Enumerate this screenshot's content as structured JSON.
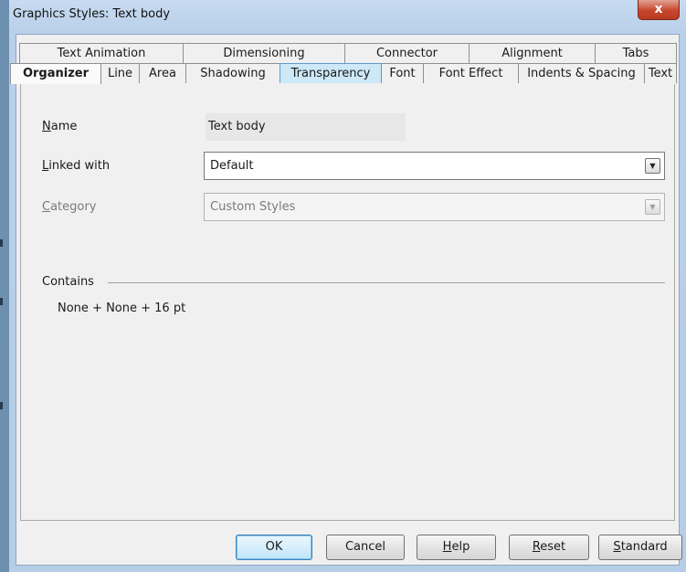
{
  "window": {
    "title": "Graphics Styles: Text body",
    "close_glyph": "x"
  },
  "tabs_back": [
    {
      "label": "Text Animation"
    },
    {
      "label": "Dimensioning"
    },
    {
      "label": "Connector"
    },
    {
      "label": "Alignment"
    },
    {
      "label": "Tabs"
    }
  ],
  "tabs_front": [
    {
      "label": "Organizer",
      "active": true
    },
    {
      "label": "Line"
    },
    {
      "label": "Area"
    },
    {
      "label": "Shadowing"
    },
    {
      "label": "Transparency",
      "hover": true
    },
    {
      "label": "Font"
    },
    {
      "label": "Font Effect"
    },
    {
      "label": "Indents & Spacing"
    },
    {
      "label": "Text"
    }
  ],
  "organizer": {
    "name_label_mn": "N",
    "name_label_rest": "ame",
    "name_value": "Text body",
    "linked_label_mn": "L",
    "linked_label_rest": "inked with",
    "linked_value": "Default",
    "category_label_mn": "C",
    "category_label_rest": "ategory",
    "category_value": "Custom Styles",
    "contains_label": "Contains",
    "contains_value": "None + None + 16 pt"
  },
  "buttons": {
    "ok": "OK",
    "cancel": "Cancel",
    "help_mn": "H",
    "help_rest": "elp",
    "reset_mn": "R",
    "reset_rest": "eset",
    "standard_mn": "S",
    "standard_rest": "tandard"
  },
  "icons": {
    "dropdown": "chevron-down-icon",
    "close": "close-icon"
  },
  "colors": {
    "title_bar": "#b9d0ea",
    "close_button": "#c7452d",
    "hover_tab": "#cde8f7",
    "default_button": "#d7effc"
  }
}
